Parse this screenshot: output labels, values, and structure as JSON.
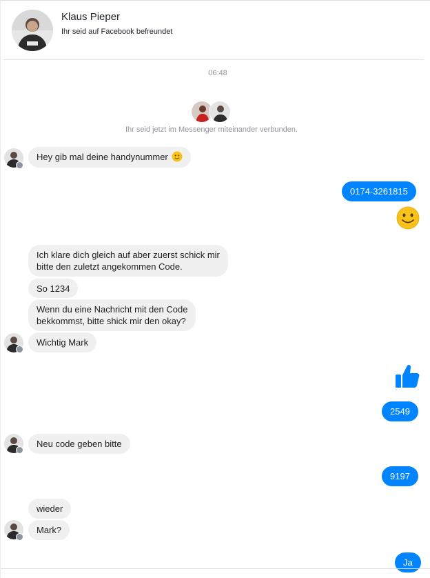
{
  "header": {
    "name": "Klaus Pieper",
    "subtitle": "Ihr seid auf Facebook befreundet"
  },
  "timestamp": "06:48",
  "connected_text": "Ihr seid jetzt im Messenger miteinander verbunden.",
  "messages": {
    "m1": "Hey gib mal deine handynummer",
    "m2": "0174-3261815",
    "m3_line1": "Ich klare dich gleich auf aber zuerst schick mir",
    "m3_line2": "bitte den zuletzt angekommen Code.",
    "m4": "So 1234",
    "m5_line1": "Wenn du eine Nachricht mit den Code",
    "m5_line2": "bekkommst, bitte shick mir den okay?",
    "m6": "Wichtig Mark",
    "m7": "2549",
    "m8": "Neu code geben bitte",
    "m9": "9197",
    "m10": "wieder",
    "m11": "Mark?",
    "m12": "Ja"
  },
  "colors": {
    "outgoing_bubble": "#0084ff",
    "incoming_bubble": "#f1f0f0",
    "meta_text": "#90949c"
  },
  "icons": {
    "inline_emoji": "slightly-smiling-face-icon",
    "big_emoji": "slightly-smiling-face-icon",
    "like": "thumbs-up-icon"
  }
}
